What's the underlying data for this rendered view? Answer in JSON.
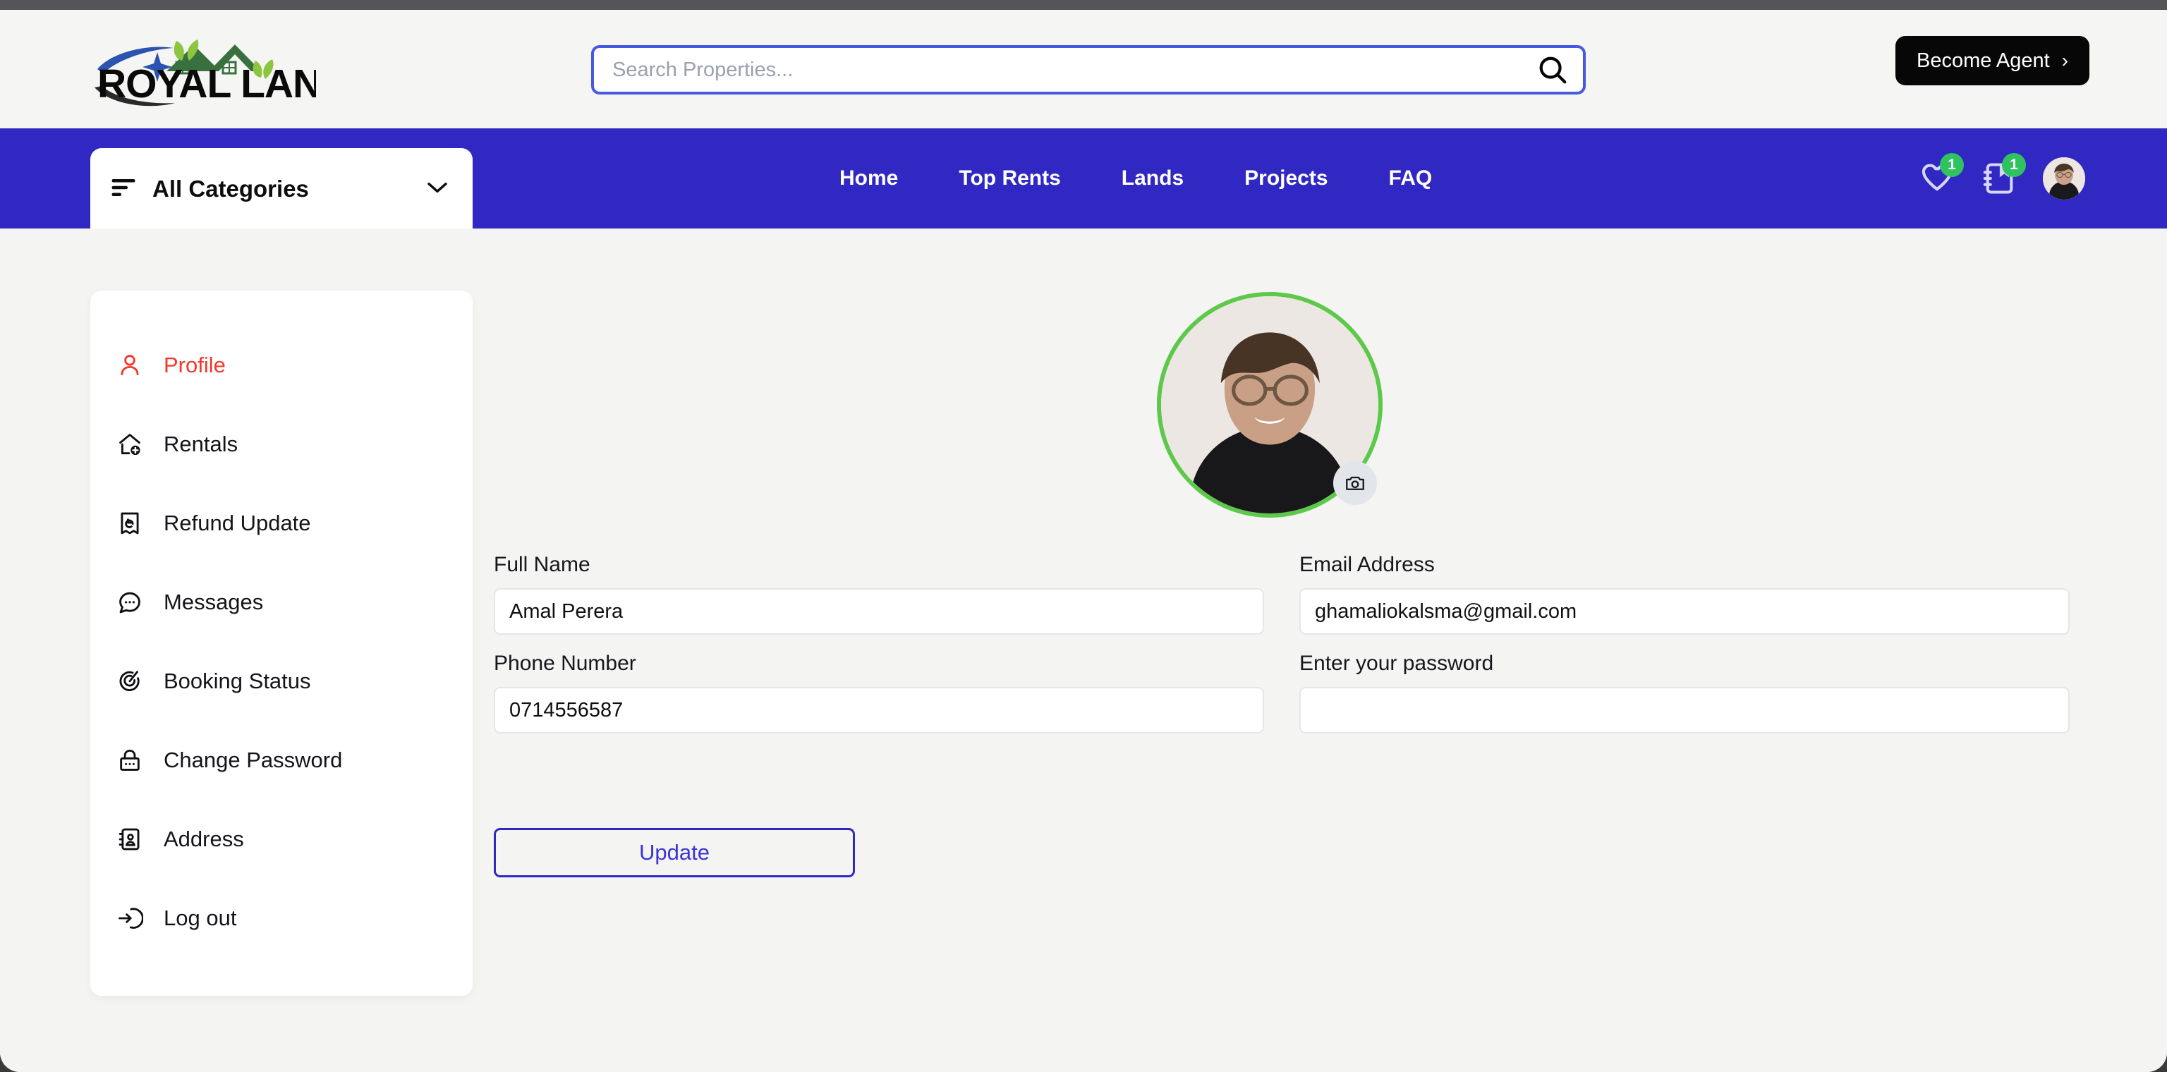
{
  "brand": {
    "name_part1": "ROYAL",
    "name_part2": "LANDS",
    "colors": {
      "primary": "#3128c4",
      "accent_green": "#5cc94a",
      "danger": "#f0392a",
      "badge_green": "#2fc360"
    }
  },
  "header": {
    "search": {
      "placeholder": "Search Properties...",
      "value": "",
      "icon": "search-icon"
    },
    "become_agent": {
      "label": "Become Agent",
      "chevron": "›"
    }
  },
  "navbar": {
    "categories": {
      "label": "All Categories",
      "menu_icon": "hamburger-icon",
      "chevron_icon": "chevron-down-icon"
    },
    "links": [
      {
        "label": "Home"
      },
      {
        "label": "Top Rents"
      },
      {
        "label": "Lands"
      },
      {
        "label": "Projects"
      },
      {
        "label": "FAQ"
      }
    ],
    "icons": {
      "wishlist": {
        "name": "heart-icon",
        "badge": "1"
      },
      "compare": {
        "name": "notebook-icon",
        "badge": "1"
      },
      "avatar": {
        "name": "user-avatar"
      }
    }
  },
  "sidebar": {
    "items": [
      {
        "label": "Profile",
        "icon": "user-icon",
        "active": true
      },
      {
        "label": "Rentals",
        "icon": "house-plus-icon",
        "active": false
      },
      {
        "label": "Refund Update",
        "icon": "receipt-refund-icon",
        "active": false
      },
      {
        "label": "Messages",
        "icon": "chat-bubble-icon",
        "active": false
      },
      {
        "label": "Booking Status",
        "icon": "target-icon",
        "active": false
      },
      {
        "label": "Change Password",
        "icon": "lock-icon",
        "active": false
      },
      {
        "label": "Address",
        "icon": "contact-book-icon",
        "active": false
      },
      {
        "label": "Log out",
        "icon": "logout-icon",
        "active": false
      }
    ]
  },
  "profile": {
    "avatar_alt": "Profile photo",
    "camera_button": {
      "icon": "camera-icon"
    },
    "fields": {
      "full_name": {
        "label": "Full Name",
        "value": "Amal Perera",
        "placeholder": ""
      },
      "email": {
        "label": "Email Address",
        "value": "ghamaliokalsma@gmail.com",
        "placeholder": ""
      },
      "phone": {
        "label": "Phone Number",
        "value": "0714556587",
        "placeholder": ""
      },
      "password": {
        "label": "Enter your password",
        "value": "",
        "placeholder": ""
      }
    },
    "update_button": {
      "label": "Update"
    }
  }
}
